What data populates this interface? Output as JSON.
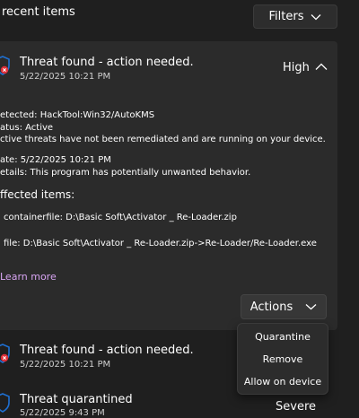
{
  "header": {
    "title": "recent items",
    "filters_label": "Filters"
  },
  "threats": [
    {
      "title": "Threat found - action needed.",
      "date": "5/22/2025 10:21 PM",
      "severity": "High",
      "expanded": true,
      "details": {
        "detected": "etected:  HackTool:Win32/AutoKMS",
        "status": "atus:  Active",
        "status_note": "ctive threats have not been remediated and are running on your device.",
        "date_line": "ate:  5/22/2025 10:21 PM",
        "details_line": "etails:  This program has potentially unwanted behavior.",
        "affected_heading": "ffected items:",
        "affected_items": [
          "containerfile: D:\\Basic Soft\\Activator _ Re-Loader.zip",
          "file: D:\\Basic Soft\\Activator _ Re-Loader.zip->Re-Loader/Re-Loader.exe"
        ],
        "learn_more": "Learn more",
        "actions_label": "Actions"
      }
    },
    {
      "title": "Threat found - action needed.",
      "date": "5/22/2025 10:21 PM"
    },
    {
      "title": "Threat quarantined",
      "date": "5/22/2025 9:43 PM",
      "severity": "Severe"
    }
  ],
  "actions_menu": [
    "Quarantine",
    "Remove",
    "Allow on device"
  ],
  "colors": {
    "background": "#1f1f1f",
    "card": "#2b2b2b",
    "link": "#d7a4f2",
    "shield": "#1f6fd1",
    "alert": "#e0303a"
  }
}
